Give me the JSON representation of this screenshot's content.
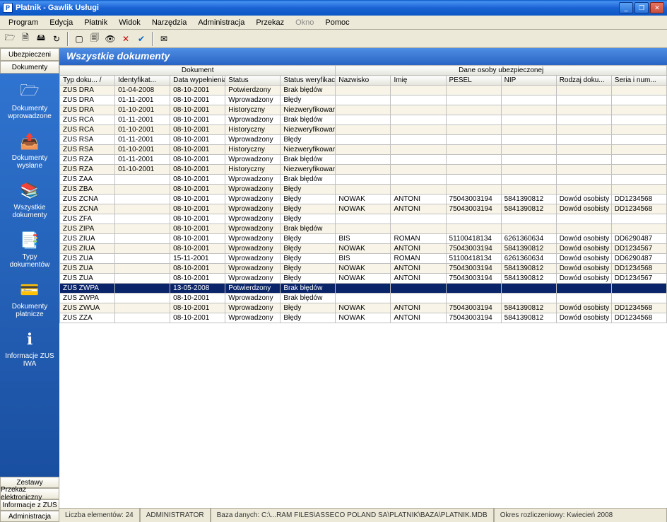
{
  "title": "Płatnik - Gawlik Usługi",
  "menus": [
    "Program",
    "Edycja",
    "Płatnik",
    "Widok",
    "Narzędzia",
    "Administracja",
    "Przekaz",
    "Okno",
    "Pomoc"
  ],
  "disabled_menu_index": 7,
  "sidebar_tabs_top": [
    "Ubezpieczeni",
    "Dokumenty"
  ],
  "sidebar_items": [
    {
      "label": "Dokumenty wprowadzone"
    },
    {
      "label": "Dokumenty wysłane"
    },
    {
      "label": "Wszystkie dokumenty"
    },
    {
      "label": "Typy dokumentów"
    },
    {
      "label": "Dokumenty płatnicze"
    },
    {
      "label": "Informacje ZUS IWA"
    }
  ],
  "sidebar_tabs_bottom": [
    "Zestawy",
    "Przekaz elektroniczny",
    "Informacje z ZUS",
    "Administracja"
  ],
  "content_title": "Wszystkie dokumenty",
  "group_headers": [
    "Dokument",
    "Dane osoby ubezpieczonej"
  ],
  "columns": [
    "Typ doku...  /",
    "Identyfikat...",
    "Data wypełnienia",
    "Status",
    "Status weryfikacji",
    "Nazwisko",
    "Imię",
    "PESEL",
    "NIP",
    "Rodzaj doku...",
    "Seria i num..."
  ],
  "rows": [
    {
      "c": [
        "ZUS DRA",
        "01-04-2008",
        "08-10-2001",
        "Potwierdzony",
        "Brak błędów",
        "",
        "",
        "",
        "",
        "",
        ""
      ]
    },
    {
      "c": [
        "ZUS DRA",
        "01-11-2001",
        "08-10-2001",
        "Wprowadzony",
        "Błędy",
        "",
        "",
        "",
        "",
        "",
        ""
      ]
    },
    {
      "c": [
        "ZUS DRA",
        "01-10-2001",
        "08-10-2001",
        "Historyczny",
        "Niezweryfikowany",
        "",
        "",
        "",
        "",
        "",
        ""
      ]
    },
    {
      "c": [
        "ZUS RCA",
        "01-11-2001",
        "08-10-2001",
        "Wprowadzony",
        "Brak błędów",
        "",
        "",
        "",
        "",
        "",
        ""
      ]
    },
    {
      "c": [
        "ZUS RCA",
        "01-10-2001",
        "08-10-2001",
        "Historyczny",
        "Niezweryfikowany",
        "",
        "",
        "",
        "",
        "",
        ""
      ]
    },
    {
      "c": [
        "ZUS RSA",
        "01-11-2001",
        "08-10-2001",
        "Wprowadzony",
        "Błędy",
        "",
        "",
        "",
        "",
        "",
        ""
      ]
    },
    {
      "c": [
        "ZUS RSA",
        "01-10-2001",
        "08-10-2001",
        "Historyczny",
        "Niezweryfikowany",
        "",
        "",
        "",
        "",
        "",
        ""
      ]
    },
    {
      "c": [
        "ZUS RZA",
        "01-11-2001",
        "08-10-2001",
        "Wprowadzony",
        "Brak błędów",
        "",
        "",
        "",
        "",
        "",
        ""
      ]
    },
    {
      "c": [
        "ZUS RZA",
        "01-10-2001",
        "08-10-2001",
        "Historyczny",
        "Niezweryfikowany",
        "",
        "",
        "",
        "",
        "",
        ""
      ]
    },
    {
      "c": [
        "ZUS ZAA",
        "",
        "08-10-2001",
        "Wprowadzony",
        "Brak błędów",
        "",
        "",
        "",
        "",
        "",
        ""
      ]
    },
    {
      "c": [
        "ZUS ZBA",
        "",
        "08-10-2001",
        "Wprowadzony",
        "Błędy",
        "",
        "",
        "",
        "",
        "",
        ""
      ]
    },
    {
      "c": [
        "ZUS ZCNA",
        "",
        "08-10-2001",
        "Wprowadzony",
        "Błędy",
        "NOWAK",
        "ANTONI",
        "75043003194",
        "5841390812",
        "Dowód osobisty",
        "DD1234568"
      ]
    },
    {
      "c": [
        "ZUS ZCNA",
        "",
        "08-10-2001",
        "Wprowadzony",
        "Błędy",
        "NOWAK",
        "ANTONI",
        "75043003194",
        "5841390812",
        "Dowód osobisty",
        "DD1234568"
      ]
    },
    {
      "c": [
        "ZUS ZFA",
        "",
        "08-10-2001",
        "Wprowadzony",
        "Błędy",
        "",
        "",
        "",
        "",
        "",
        ""
      ]
    },
    {
      "c": [
        "ZUS ZIPA",
        "",
        "08-10-2001",
        "Wprowadzony",
        "Brak błędów",
        "",
        "",
        "",
        "",
        "",
        ""
      ]
    },
    {
      "c": [
        "ZUS ZIUA",
        "",
        "08-10-2001",
        "Wprowadzony",
        "Błędy",
        "BIS",
        "ROMAN",
        "51100418134",
        "6261360634",
        "Dowód osobisty",
        "DD6290487"
      ]
    },
    {
      "c": [
        "ZUS ZIUA",
        "",
        "08-10-2001",
        "Wprowadzony",
        "Błędy",
        "NOWAK",
        "ANTONI",
        "75043003194",
        "5841390812",
        "Dowód osobisty",
        "DD1234567"
      ]
    },
    {
      "c": [
        "ZUS ZUA",
        "",
        "15-11-2001",
        "Wprowadzony",
        "Błędy",
        "BIS",
        "ROMAN",
        "51100418134",
        "6261360634",
        "Dowód osobisty",
        "DD6290487"
      ]
    },
    {
      "c": [
        "ZUS ZUA",
        "",
        "08-10-2001",
        "Wprowadzony",
        "Błędy",
        "NOWAK",
        "ANTONI",
        "75043003194",
        "5841390812",
        "Dowód osobisty",
        "DD1234568"
      ]
    },
    {
      "c": [
        "ZUS ZUA",
        "",
        "08-10-2001",
        "Wprowadzony",
        "Błędy",
        "NOWAK",
        "ANTONI",
        "75043003194",
        "5841390812",
        "Dowód osobisty",
        "DD1234567"
      ]
    },
    {
      "c": [
        "ZUS ZWPA",
        "",
        "13-05-2008",
        "Potwierdzony",
        "Brak błędów",
        "",
        "",
        "",
        "",
        "",
        ""
      ],
      "selected": true
    },
    {
      "c": [
        "ZUS ZWPA",
        "",
        "08-10-2001",
        "Wprowadzony",
        "Brak błędów",
        "",
        "",
        "",
        "",
        "",
        ""
      ]
    },
    {
      "c": [
        "ZUS ZWUA",
        "",
        "08-10-2001",
        "Wprowadzony",
        "Błędy",
        "NOWAK",
        "ANTONI",
        "75043003194",
        "5841390812",
        "Dowód osobisty",
        "DD1234568"
      ]
    },
    {
      "c": [
        "ZUS ZZA",
        "",
        "08-10-2001",
        "Wprowadzony",
        "Błędy",
        "NOWAK",
        "ANTONI",
        "75043003194",
        "5841390812",
        "Dowód osobisty",
        "DD1234568"
      ]
    }
  ],
  "status": {
    "count": "Liczba elementów: 24",
    "user": "ADMINISTRATOR",
    "db": "Baza danych: C:\\...RAM FILES\\ASSECO POLAND SA\\PLATNIK\\BAZA\\PLATNIK.MDB",
    "period": "Okres rozliczeniowy: Kwiecień 2008"
  }
}
